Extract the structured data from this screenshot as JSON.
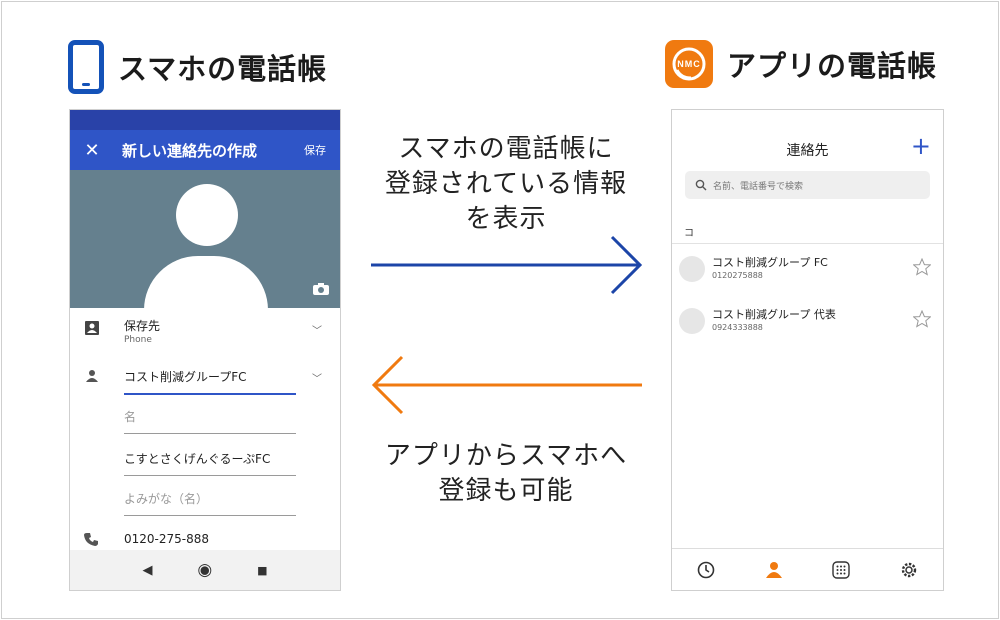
{
  "left_heading": {
    "title": "スマホの電話帳"
  },
  "right_heading": {
    "title": "アプリの電話帳",
    "logo_text": "NMC"
  },
  "phone_form": {
    "close_label": "✕",
    "title": "新しい連絡先の作成",
    "save_label": "保存",
    "storage_label": "保存先",
    "storage_value": "Phone",
    "name_value": "コスト削減グループFC",
    "given_name_placeholder": "名",
    "phonetic_family_value": "こすとさくげんぐるーぷFC",
    "phonetic_given_placeholder": "よみがな（名）",
    "phone_value": "0120-275-888",
    "nav_back": "◀",
    "nav_home": "◉",
    "nav_recent": "■"
  },
  "center": {
    "top_lines": [
      "スマホの電話帳に",
      "登録されている情報",
      "を表示"
    ],
    "bottom_lines": [
      "アプリからスマホへ",
      "登録も可能"
    ],
    "colors": {
      "blue_arrow": "#1c45a8",
      "orange_arrow": "#f07a10"
    }
  },
  "app_contacts": {
    "title": "連絡先",
    "add_label": "+",
    "search_placeholder": "名前、電話番号で検索",
    "section_label": "コ",
    "contacts": [
      {
        "name": "コスト削減グループ FC",
        "number": "0120275888"
      },
      {
        "name": "コスト削減グループ 代表",
        "number": "0924333888"
      }
    ],
    "tabs": [
      "history-icon",
      "contacts-icon",
      "keypad-icon",
      "settings-icon"
    ],
    "active_tab": "contacts-icon",
    "accent": "#f07a10"
  }
}
